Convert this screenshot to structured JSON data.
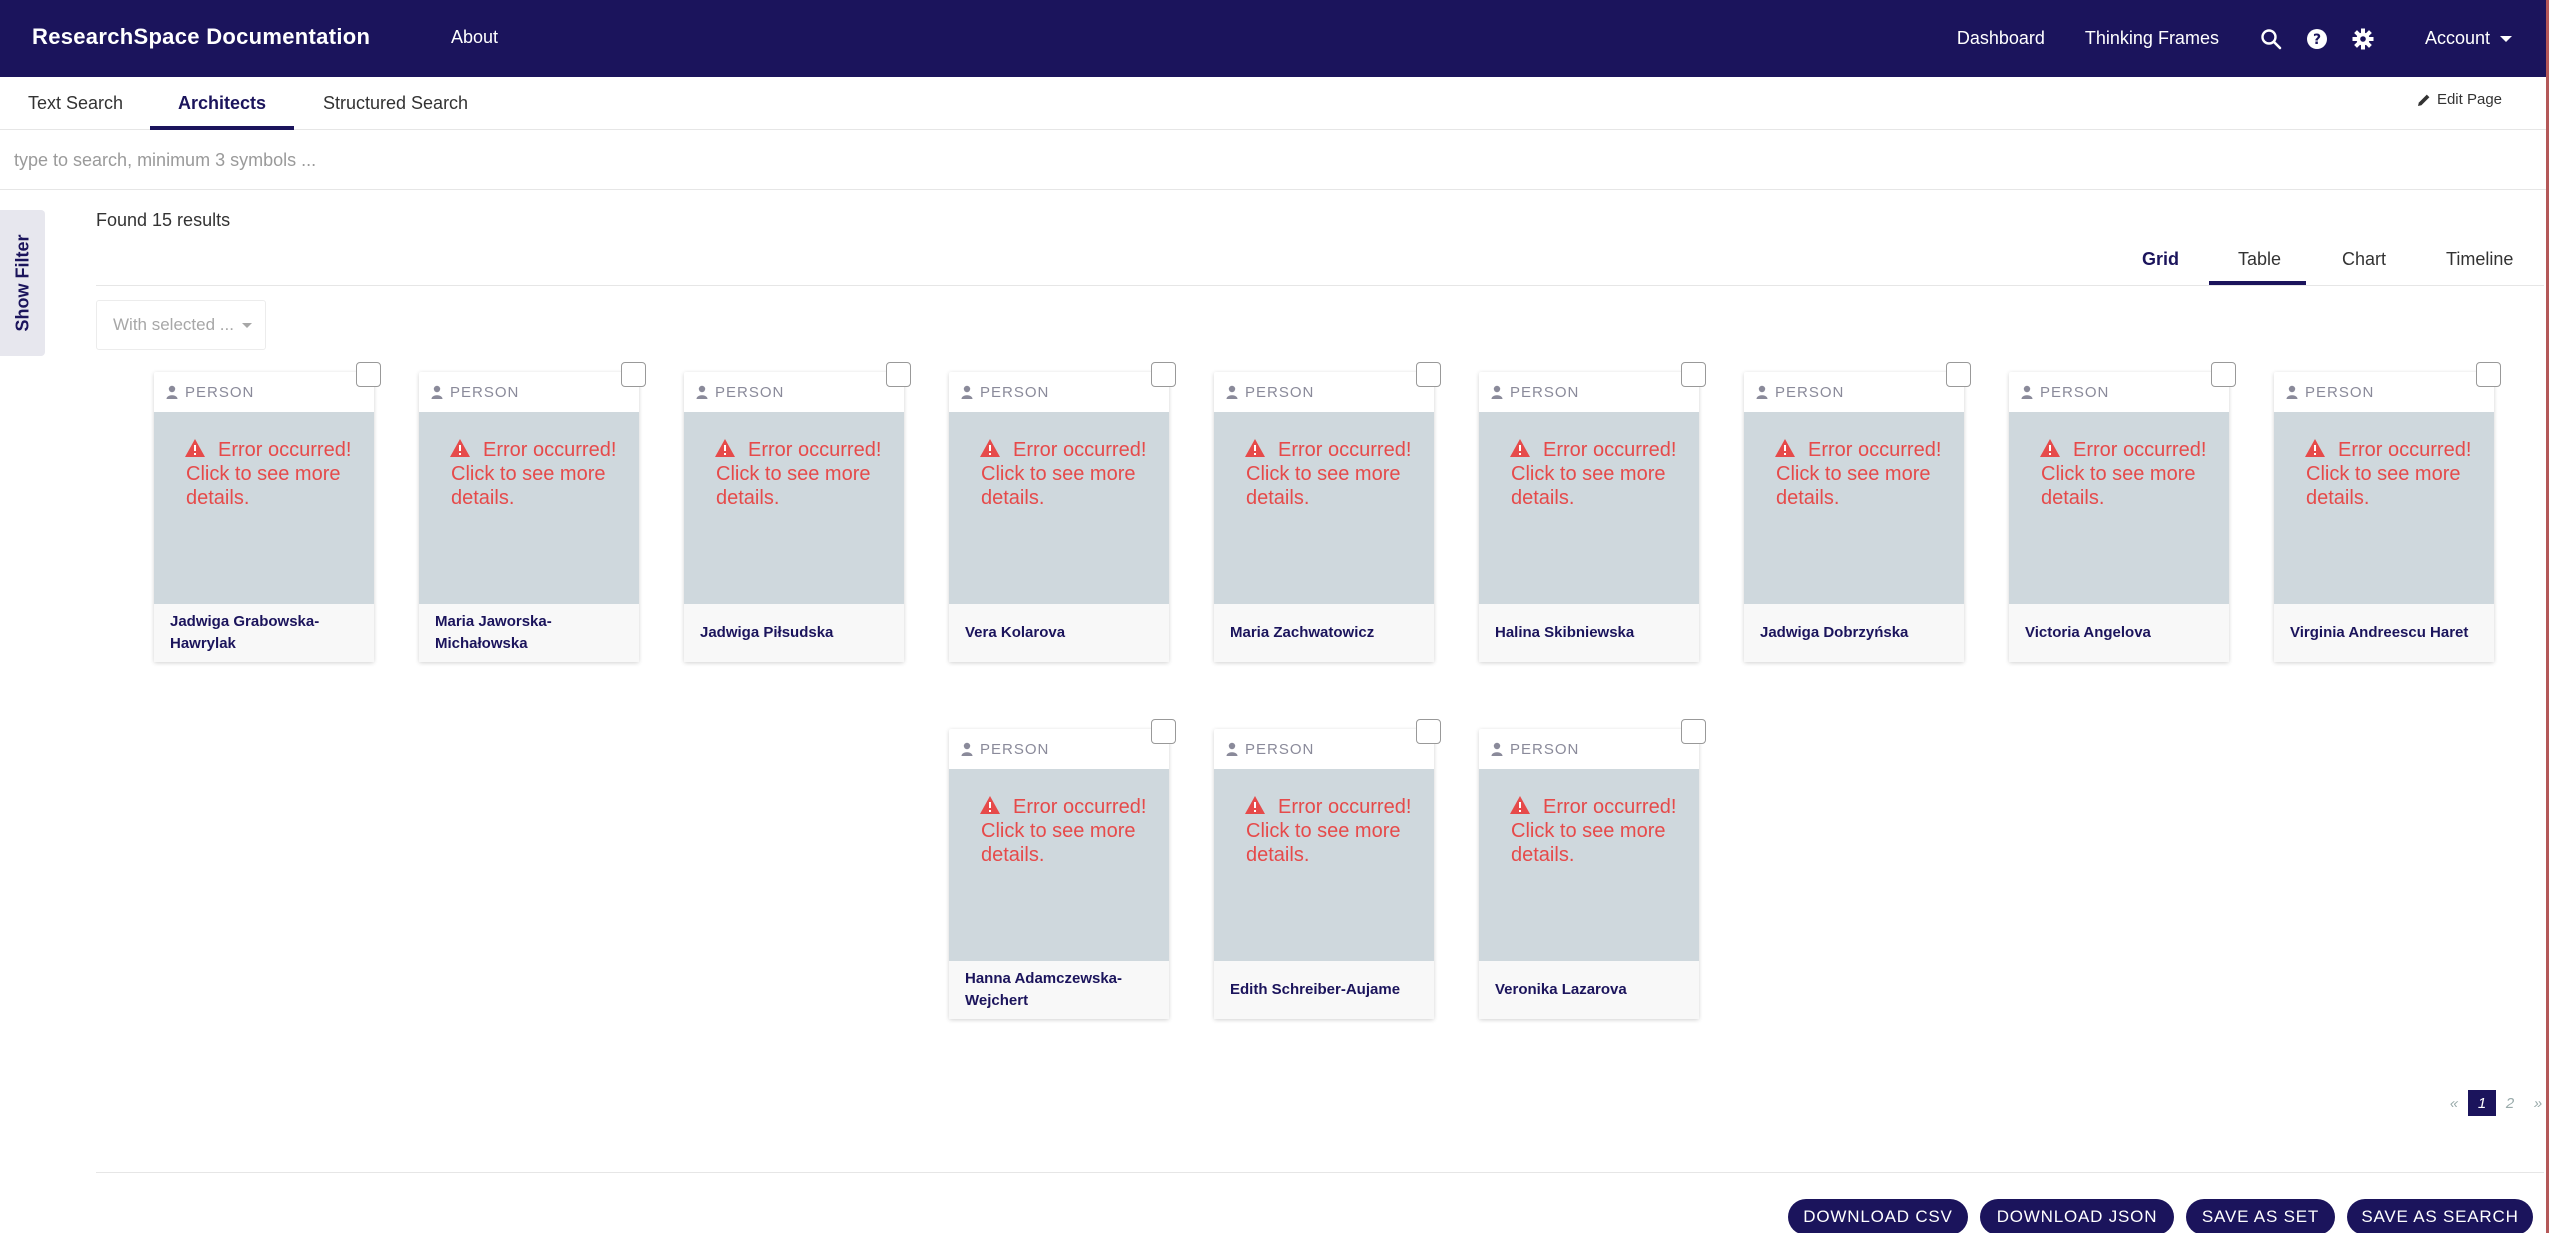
{
  "header": {
    "brand": "ResearchSpace Documentation",
    "about": "About",
    "dashboard": "Dashboard",
    "thinking_frames": "Thinking Frames",
    "account": "Account",
    "icons": [
      "search-icon",
      "help-icon",
      "gear-icon"
    ]
  },
  "subtabs": {
    "text_search": "Text Search",
    "architects": "Architects",
    "structured_search": "Structured Search",
    "edit_page": "Edit Page"
  },
  "search": {
    "placeholder": "type to search, minimum 3 symbols ..."
  },
  "filter": {
    "show_filter": "Show Filter"
  },
  "results": {
    "found": "Found 15 results",
    "with_selected": "With selected ..."
  },
  "view_tabs": {
    "grid": "Grid",
    "table": "Table",
    "chart": "Chart",
    "timeline": "Timeline",
    "active": "Grid"
  },
  "card_type": "PERSON",
  "error_text": "Error occurred! Click to see more details.",
  "cards": [
    "Jadwiga Grabowska-Hawrylak",
    "Maria Jaworska-Michałowska",
    "Jadwiga Piłsudska",
    "Vera Kolarova",
    "Maria Zachwatowicz",
    "Halina Skibniewska",
    "Jadwiga Dobrzyńska",
    "Victoria Angelova",
    "Virginia Andreescu Haret",
    "Hanna Adamczewska-Wejchert",
    "Edith Schreiber-Aujame",
    "Veronika Lazarova"
  ],
  "pagination": {
    "prev": "«",
    "pages": [
      "1",
      "2"
    ],
    "current": "1",
    "next": "»"
  },
  "buttons": {
    "download_csv": "DOWNLOAD CSV",
    "download_json": "DOWNLOAD JSON",
    "save_as_set": "SAVE AS SET",
    "save_as_search": "SAVE AS SEARCH"
  },
  "colors": {
    "brand": "#1b145c",
    "error": "#e64a4a",
    "card_image_bg": "#cfd8dd"
  }
}
